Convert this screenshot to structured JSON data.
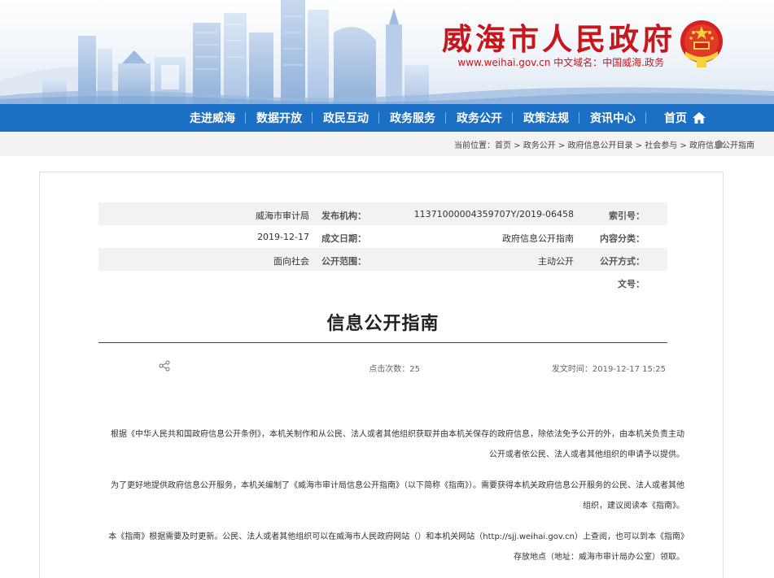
{
  "header": {
    "site_title": "威海市人民政府",
    "site_subtitle": "www.weihai.gov.cn  中文域名：中国威海.政务",
    "brand_color": "#c8161d"
  },
  "nav": {
    "home_label": "首页",
    "items": [
      {
        "label": "资讯中心"
      },
      {
        "label": "政策法规"
      },
      {
        "label": "政务公开"
      },
      {
        "label": "政务服务"
      },
      {
        "label": "政民互动"
      },
      {
        "label": "数据开放"
      },
      {
        "label": "走进威海"
      }
    ],
    "bar_color": "#1b6fc4"
  },
  "breadcrumb": {
    "text": "当前位置：首页 > 政务公开 > 政府信息公开目录 > 社会参与 > 政府信息公开指南"
  },
  "meta": {
    "index_label": "索引号：",
    "index_value": "11371000004359707Y/2019-06458",
    "publisher_label": "发布机构：",
    "publisher_value": "威海市审计局",
    "category_label": "内容分类：",
    "category_value": "政府信息公开指南",
    "date_label": "成文日期：",
    "date_value": "2019-12-17",
    "mode_label": "公开方式：",
    "mode_value": "主动公开",
    "scope_label": "公开范围：",
    "scope_value": "面向社会",
    "docno_label": "文号："
  },
  "article": {
    "title": "信息公开指南",
    "publish_time": "发文时间：2019-12-17 15:25",
    "clicks": "点击次数：25",
    "paragraphs": [
      "根据《中华人民共和国政府信息公开条例》，本机关制作和从公民、法人或者其他组织获取并由本机关保存的政府信息，除依法免予公开的外，由本机关负责主动公开或者依公民、法人或者其他组织的申请予以提供。",
      "为了更好地提供政府信息公开服务，本机关编制了《威海市审计局信息公开指南》（以下简称《指南》）。需要获得本机关政府信息公开服务的公民、法人或者其他组织，建议阅读本《指南》。",
      "本《指南》根据需要及时更新。公民、法人或者其他组织可以在威海市人民政府网站（）和本机关网站（http://sjj.weihai.gov.cn）上查阅，也可以到本《指南》存放地点（地址：威海市审计局办公室）领取。"
    ]
  }
}
